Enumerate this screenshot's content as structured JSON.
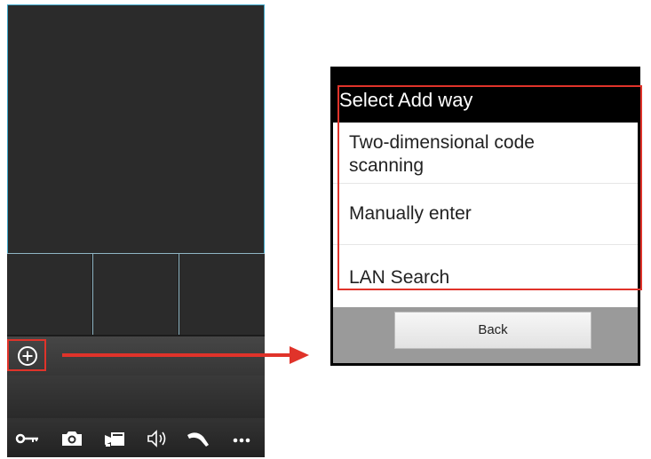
{
  "dialog": {
    "title": "Select Add way",
    "options": [
      {
        "label_line1": "Two-dimensional code",
        "label_line2": "scanning"
      },
      {
        "label": "Manually enter"
      },
      {
        "label": "LAN Search"
      }
    ],
    "back_label": "Back"
  },
  "app": {
    "add_icon": "plus-circle-icon",
    "toolbar_icons": [
      "key-icon",
      "camera-icon",
      "video-camera-icon",
      "speaker-icon",
      "phone-icon",
      "more-icon"
    ]
  },
  "colors": {
    "highlight": "#e0332a",
    "view_border": "#3ea6c8",
    "dialog_header": "#000000"
  }
}
